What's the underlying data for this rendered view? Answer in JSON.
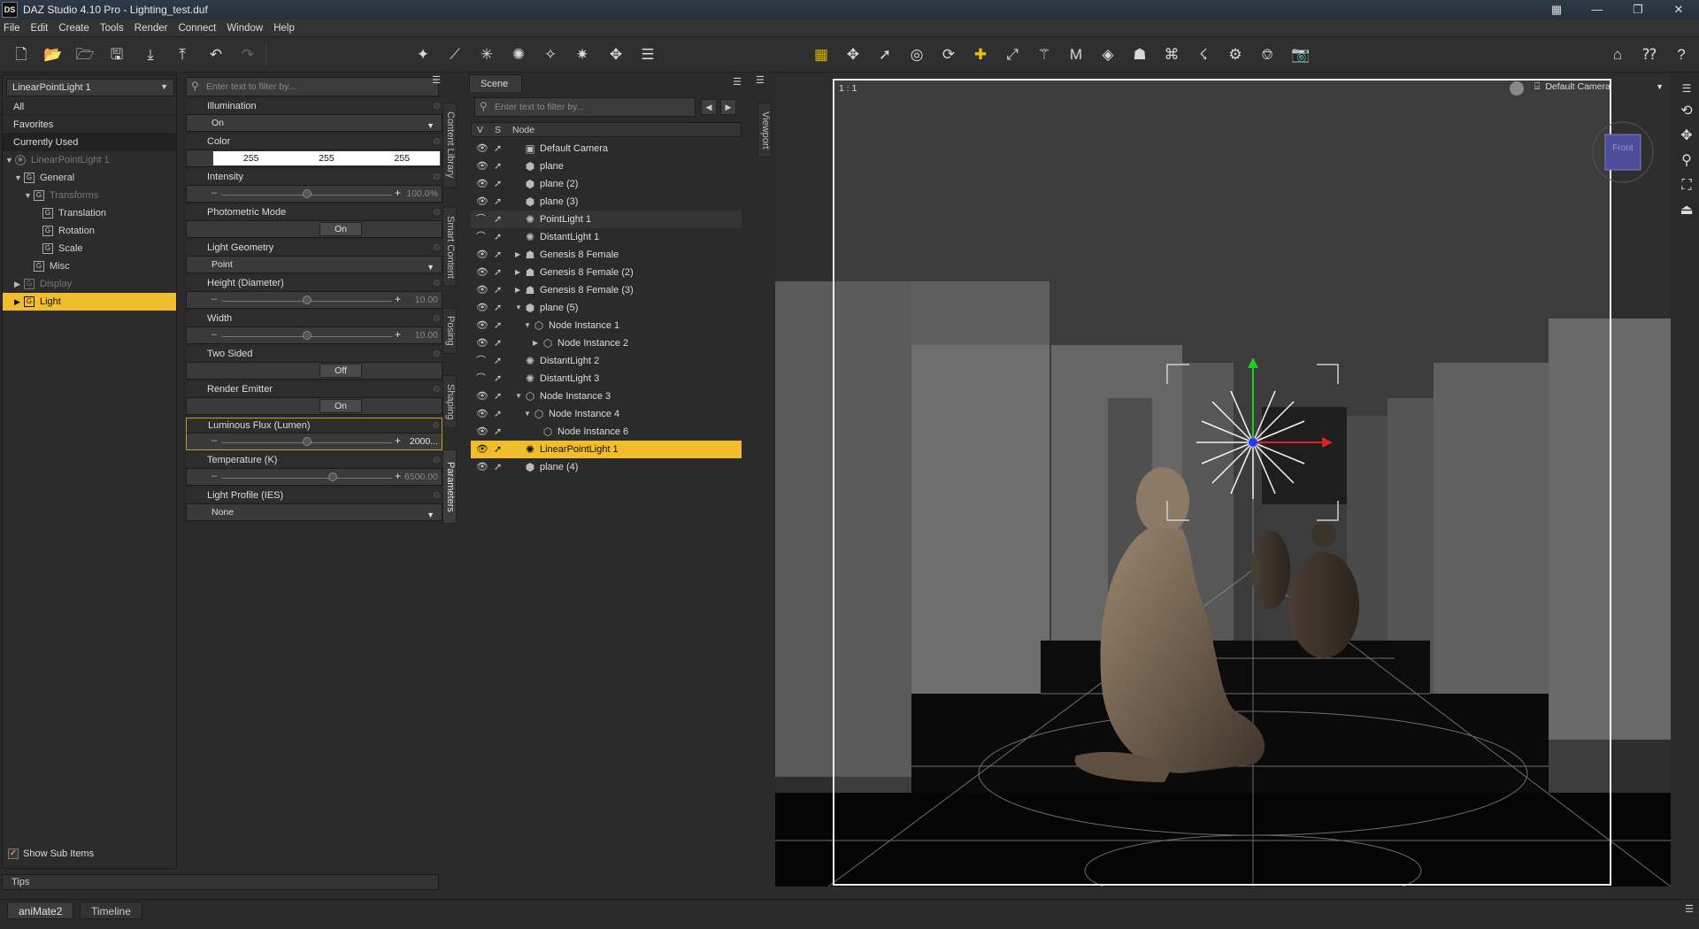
{
  "app": {
    "window_title": "DAZ Studio 4.10 Pro - Lighting_test.duf",
    "icon_text": "DS",
    "minimize": "—",
    "restore": "❐",
    "close": "✕"
  },
  "menu": [
    "File",
    "Edit",
    "Create",
    "Tools",
    "Render",
    "Connect",
    "Window",
    "Help"
  ],
  "left_panel": {
    "selector": "LinearPointLight 1",
    "categories": [
      "All",
      "Favorites",
      "Currently Used"
    ],
    "tree": [
      {
        "label": "LinearPointLight 1",
        "dim": true
      },
      {
        "label": "General"
      },
      {
        "label": "Transforms",
        "dim": true
      },
      {
        "label": "Translation"
      },
      {
        "label": "Rotation"
      },
      {
        "label": "Scale"
      },
      {
        "label": "Misc"
      },
      {
        "label": "Display",
        "dim": true
      },
      {
        "label": "Light",
        "selected": true
      }
    ],
    "show_sub_items": "Show Sub Items"
  },
  "parameters": {
    "filter_placeholder": "Enter text to filter by...",
    "illumination": {
      "label": "Illumination",
      "value": "On"
    },
    "color": {
      "label": "Color",
      "r": "255",
      "g": "255",
      "b": "255"
    },
    "intensity": {
      "label": "Intensity",
      "value": "100.0%",
      "fraction": 0.5
    },
    "photometric_mode": {
      "label": "Photometric Mode",
      "value": "On"
    },
    "light_geometry": {
      "label": "Light Geometry",
      "value": "Point"
    },
    "height": {
      "label": "Height (Diameter)",
      "value": "10.00",
      "fraction": 0.5
    },
    "width": {
      "label": "Width",
      "value": "10.00",
      "fraction": 0.5
    },
    "two_sided": {
      "label": "Two Sided",
      "value": "Off"
    },
    "render_emitter": {
      "label": "Render Emitter",
      "value": "On"
    },
    "luminous_flux": {
      "label": "Luminous Flux (Lumen)",
      "value": "2000...",
      "fraction": 0.5
    },
    "temperature": {
      "label": "Temperature (K)",
      "value": "6500.00",
      "fraction": 0.65
    },
    "light_profile": {
      "label": "Light Profile (IES)",
      "value": "None"
    }
  },
  "side_tabs_left": [
    "Content Library",
    "Smart Content",
    "Posing",
    "Shaping",
    "Parameters"
  ],
  "scene": {
    "tab": "Scene",
    "filter_placeholder": "Enter text to filter by...",
    "columns": {
      "v": "V",
      "s": "S",
      "node": "Node"
    },
    "nodes": [
      {
        "label": "Default Camera",
        "icon": "camera"
      },
      {
        "label": "plane",
        "icon": "cube"
      },
      {
        "label": "plane (2)",
        "icon": "cube"
      },
      {
        "label": "plane (3)",
        "icon": "cube"
      },
      {
        "label": "PointLight 1",
        "icon": "light"
      },
      {
        "label": "DistantLight 1",
        "icon": "light"
      },
      {
        "label": "Genesis 8 Female",
        "icon": "figure"
      },
      {
        "label": "Genesis 8 Female (2)",
        "icon": "figure"
      },
      {
        "label": "Genesis 8 Female (3)",
        "icon": "figure"
      },
      {
        "label": "plane (5)",
        "icon": "cube"
      },
      {
        "label": "Node Instance 1",
        "icon": "instance"
      },
      {
        "label": "Node Instance 2",
        "icon": "instance"
      },
      {
        "label": "DistantLight 2",
        "icon": "light"
      },
      {
        "label": "DistantLight 3",
        "icon": "light"
      },
      {
        "label": "Node Instance 3",
        "icon": "instance"
      },
      {
        "label": "Node Instance 4",
        "icon": "instance"
      },
      {
        "label": "Node Instance 6",
        "icon": "instance"
      },
      {
        "label": "LinearPointLight 1",
        "icon": "light"
      },
      {
        "label": "plane (4)",
        "icon": "cube"
      }
    ]
  },
  "side_tab_viewport": "Viewport",
  "viewport": {
    "aspect_label": "1 : 1",
    "camera": "Default Camera",
    "view_cube": "Front"
  },
  "bottom": {
    "tips": "Tips",
    "tabs": [
      "aniMate2",
      "Timeline"
    ]
  },
  "colors": {
    "accent": "#f2bd2c",
    "panel": "#2b2b2b"
  }
}
